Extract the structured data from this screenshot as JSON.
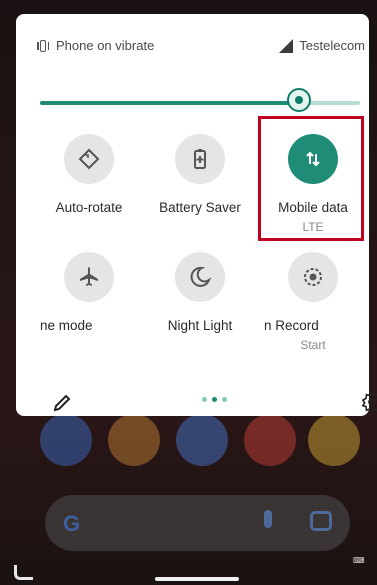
{
  "status_bar": {
    "ringer_text": "Phone on vibrate",
    "carrier": "Testelecom"
  },
  "brightness": {
    "level": 0.81
  },
  "tiles": [
    {
      "label": "Auto-rotate",
      "sublabel": "",
      "icon": "auto-rotate-icon",
      "active": false
    },
    {
      "label": "Battery Saver",
      "sublabel": "",
      "icon": "battery-saver-icon",
      "active": false
    },
    {
      "label": "Mobile data",
      "sublabel": "LTE",
      "icon": "mobile-data-icon",
      "active": true
    },
    {
      "label": "ne mode",
      "sublabel": "",
      "icon": "airplane-icon",
      "active": false
    },
    {
      "label": "Night Light",
      "sublabel": "",
      "icon": "night-light-icon",
      "active": false
    },
    {
      "label": "n Record",
      "sublabel": "Start",
      "icon": "screen-record-icon",
      "active": false
    }
  ],
  "footer": {
    "page_count": 3,
    "current_page": 1
  },
  "colors": {
    "accent": "#1f8c78",
    "highlight_box": "#c00020"
  }
}
